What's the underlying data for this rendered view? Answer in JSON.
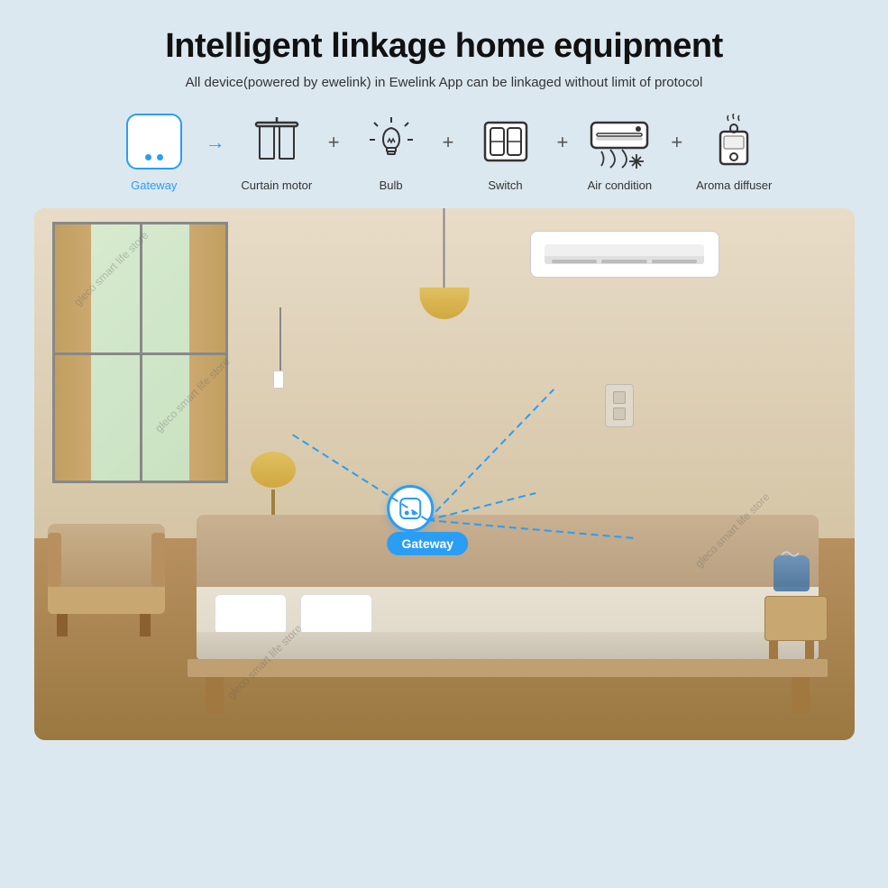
{
  "page": {
    "title": "Intelligent linkage home equipment",
    "subtitle": "All device(powered by ewelink) in Ewelink App can be linkaged without limit of protocol",
    "background_color": "#dce8f0"
  },
  "devices": [
    {
      "id": "gateway",
      "label": "Gateway",
      "label_color": "blue"
    },
    {
      "id": "curtain",
      "label": "Curtain motor",
      "label_color": "normal"
    },
    {
      "id": "bulb",
      "label": "Bulb",
      "label_color": "normal"
    },
    {
      "id": "switch",
      "label": "Switch",
      "label_color": "normal"
    },
    {
      "id": "ac",
      "label": "Air condition",
      "label_color": "normal"
    },
    {
      "id": "aroma",
      "label": "Aroma diffuser",
      "label_color": "normal"
    }
  ],
  "room": {
    "gateway_label": "Gateway"
  },
  "watermarks": [
    "gleco smart life store",
    "gleco smart life store",
    "gleco smart life store",
    "gleco smart life store"
  ]
}
